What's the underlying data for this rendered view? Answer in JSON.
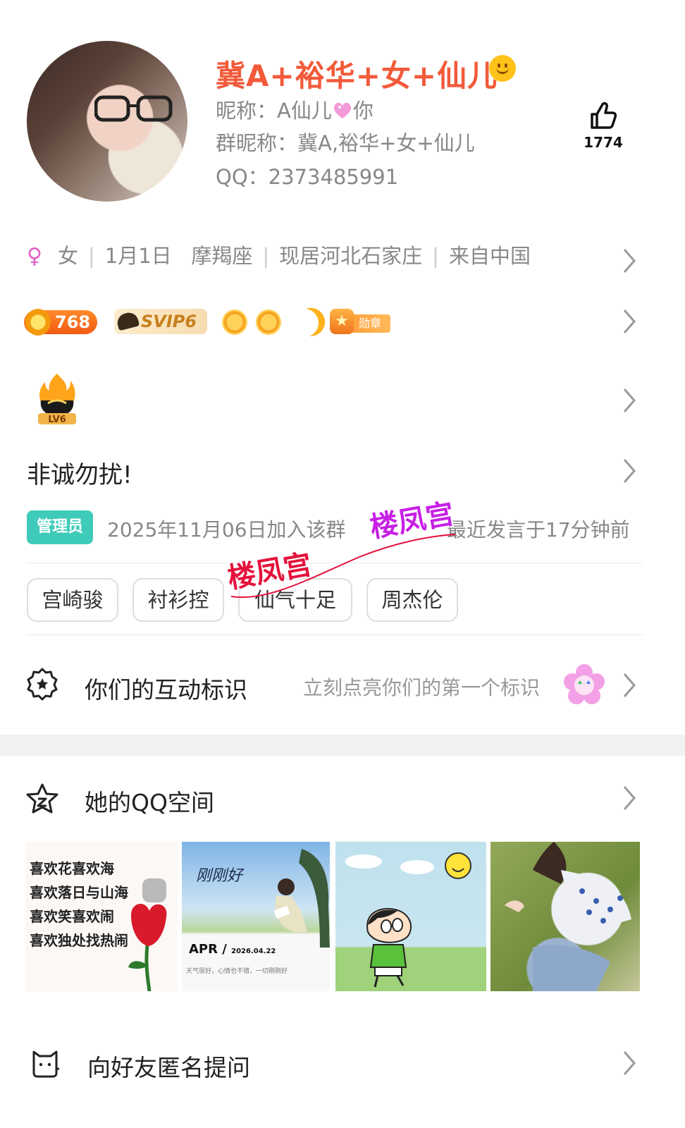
{
  "header": {
    "display_name": "冀A+裕华+女+仙儿",
    "nickname_label": "昵称：",
    "nickname_value_pre": "A仙儿",
    "nickname_value_post": "你",
    "group_nickname_label": "群昵称：",
    "group_nickname_value": "冀A,裕华+女+仙儿",
    "qq_label": "QQ：",
    "qq_value": "2373485991",
    "likes": "1774"
  },
  "profile": {
    "gender_symbol": "♀",
    "gender": "女",
    "birthday": "1月1日",
    "zodiac": "摩羯座",
    "residence": "现居河北石家庄",
    "origin": "来自中国",
    "separator": "|"
  },
  "badges": {
    "level_points": "768",
    "svip": "SVIP6",
    "medal_label": "勋章"
  },
  "group_level": "LV6",
  "status_text": "非诚勿扰!",
  "membership": {
    "role": "管理员",
    "joined": "2025年11月06日加入该群",
    "last_spoke": "最近发言于17分钟前"
  },
  "interest_tags": [
    "宫崎骏",
    "衬衫控",
    "仙气十足",
    "周杰伦"
  ],
  "interaction": {
    "title": "你们的互动标识",
    "hint": "立刻点亮你们的第一个标识"
  },
  "qzone": {
    "title": "她的QQ空间",
    "photos": [
      {
        "lines": [
          "喜欢花喜欢海",
          "喜欢落日与山海",
          "喜欢笑喜欢闹",
          "喜欢独处找热闹"
        ]
      },
      {
        "title": "刚刚好",
        "month": "APR /",
        "date": "2026.04.22",
        "caption": "天气很好，心情也不错，一切刚刚好"
      },
      {},
      {}
    ]
  },
  "anonymous_ask": {
    "title": "向好友匿名提问"
  },
  "watermark": "楼凤宫",
  "colors": {
    "name": "#f25a3a",
    "admin_tag": "#3fcbb9",
    "watermark_purple": "#c71fe6",
    "watermark_red": "#e5123c",
    "female": "#e35ec7"
  },
  "icons": {
    "like": "thumbs-up-icon",
    "chevron": "chevron-right-icon",
    "interaction": "badge-star-icon",
    "qzone": "qzone-star-icon",
    "ask": "cat-face-icon"
  }
}
